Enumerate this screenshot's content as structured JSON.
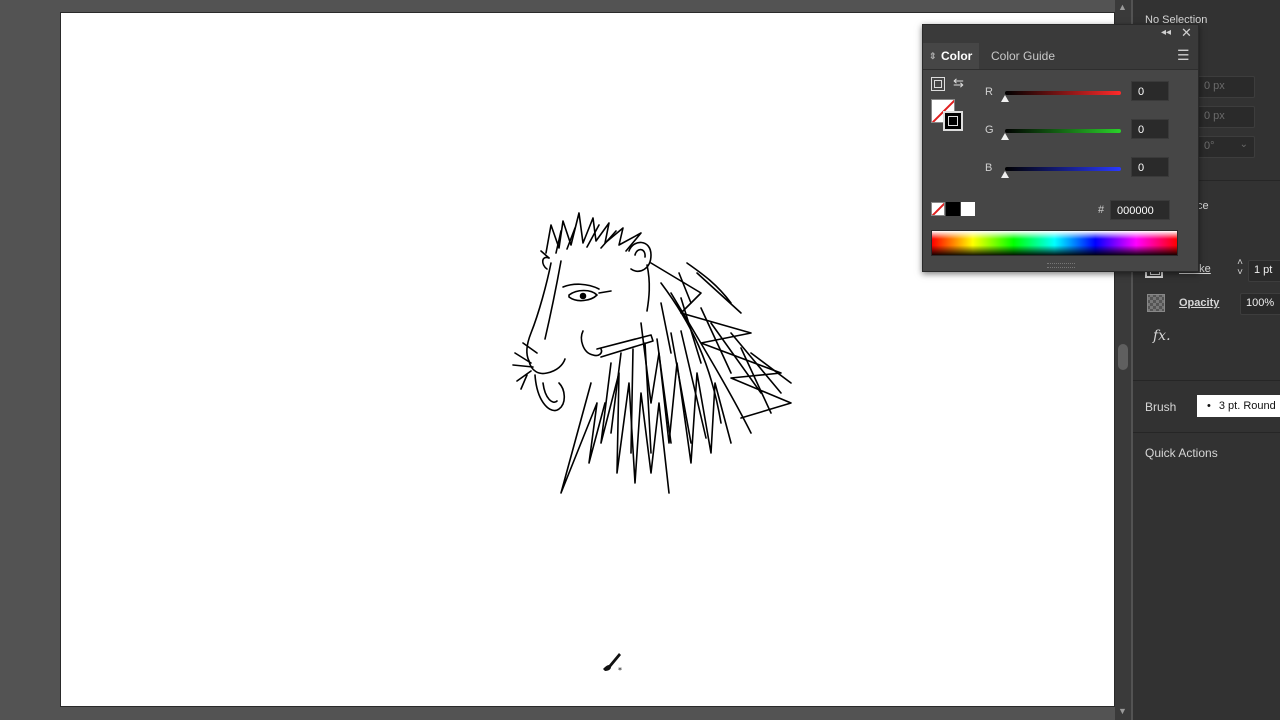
{
  "color_panel": {
    "tabs": [
      "Color",
      "Color Guide"
    ],
    "sliders": [
      {
        "label": "R",
        "value": "0",
        "gradient_end": "#ff2a2a"
      },
      {
        "label": "G",
        "value": "0",
        "gradient_end": "#2ad22a"
      },
      {
        "label": "B",
        "value": "0",
        "gradient_end": "#2a3aff"
      }
    ],
    "hash_symbol": "#",
    "hex_value": "000000",
    "icons": {
      "collapse": "double-chevron-left",
      "close": "close-x",
      "menu": "hamburger"
    }
  },
  "properties_panel": {
    "selection_label": "No Selection",
    "disabled_values": [
      "0 px",
      "0 px",
      "0°"
    ],
    "partial_label": "ce",
    "stroke_label": "Stroke",
    "stroke_value": "1 pt",
    "opacity_label": "Opacity",
    "opacity_value": "100%",
    "fx_label": "fx.",
    "brush_label": "Brush",
    "brush_value": "3 pt. Round",
    "quick_actions_label": "Quick Actions"
  },
  "canvas": {
    "artboard_color": "#ffffff",
    "pasteboard_color": "#535353",
    "drawing": "lion-head-sketch",
    "cursor": "paintbrush-cursor"
  }
}
